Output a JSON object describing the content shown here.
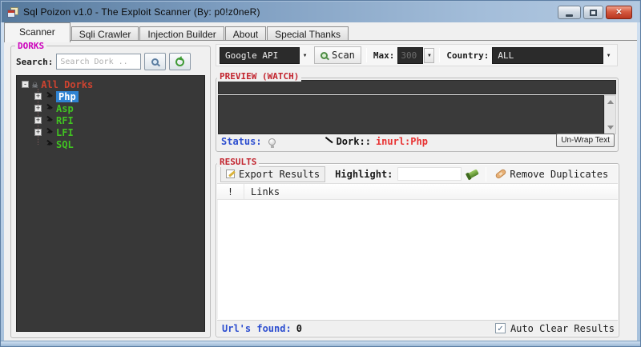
{
  "window": {
    "title": "Sql Poizon v1.0 - The Exploit Scanner (By: p0!z0neR)"
  },
  "tabs": [
    {
      "label": "Scanner",
      "active": true
    },
    {
      "label": "Sqli Crawler",
      "active": false
    },
    {
      "label": "Injection Builder",
      "active": false
    },
    {
      "label": "About",
      "active": false
    },
    {
      "label": "Special Thanks",
      "active": false
    }
  ],
  "dorks": {
    "group_label": "DORKS",
    "search_label": "Search:",
    "search_placeholder": "Search Dork ..",
    "tree": {
      "root": {
        "label": "All Dorks",
        "expander": "-"
      },
      "children": [
        {
          "label": "Php",
          "expander": "+",
          "selected": true
        },
        {
          "label": "Asp",
          "expander": "+",
          "selected": false
        },
        {
          "label": "RFI",
          "expander": "+",
          "selected": false
        },
        {
          "label": "LFI",
          "expander": "+",
          "selected": false
        },
        {
          "label": "SQL",
          "expander": "",
          "selected": false
        }
      ]
    }
  },
  "toolbar": {
    "engine_value": "Google API",
    "scan_label": "Scan",
    "max_label": "Max:",
    "max_value": "300",
    "country_label": "Country:",
    "country_value": "ALL"
  },
  "preview": {
    "group_label": "PREVIEW (WATCH)",
    "status_label": "Status:",
    "dork_label": "Dork::",
    "dork_value": "inurl:Php",
    "unwrap_button": "Un-Wrap Text"
  },
  "results": {
    "group_label": "RESULTS",
    "export_button": "Export Results",
    "highlight_label": "Highlight:",
    "remove_duplicates_button": "Remove Duplicates",
    "columns": {
      "flag": "!",
      "links": "Links"
    },
    "urls_found_label": "Url's found:",
    "urls_found_value": "0",
    "auto_clear_label": "Auto Clear Results",
    "auto_clear_checked": true
  },
  "colors": {
    "titlebar_blue": "#7d9dc0",
    "dorks_label": "#cc00bb",
    "section_label_red": "#c2242e",
    "tree_background": "#383838",
    "tree_root_text": "#cd4330",
    "tree_child_text": "#41c222",
    "selection_blue": "#2f83d3",
    "status_blue": "#2e4fd0",
    "dork_value_red": "#e83232",
    "dark_combo": "#2b2b2b"
  }
}
